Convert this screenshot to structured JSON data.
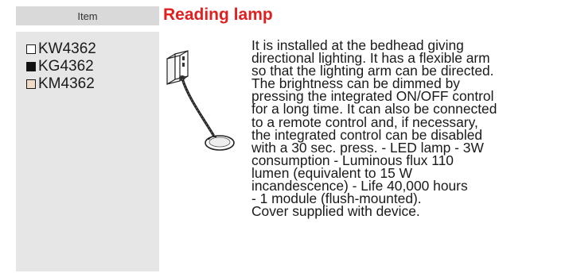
{
  "sidebar": {
    "header_label": "Item",
    "variants": [
      {
        "code": "KW4362",
        "swatch_color": "#ffffff"
      },
      {
        "code": "KG4362",
        "swatch_color": "#111111"
      },
      {
        "code": "KM4362",
        "swatch_color": "#f3dcc7"
      }
    ]
  },
  "product": {
    "title": "Reading lamp",
    "title_color": "#e02020",
    "description_lines": [
      "It is installed at the bedhead giving",
      "directional lighting. It has a flexible arm",
      "so that the lighting arm can be directed.",
      "The brightness can be dimmed by",
      "pressing the integrated ON/OFF control",
      "for a long time. It can also be connected",
      "to a remote control and, if  necessary,",
      "the integrated control can be disabled",
      "with a 30 sec. press. - LED lamp - 3W",
      "consumption - Luminous flux 110",
      "lumen (equivalent to 15 W",
      "incandescence) - Life 40,000 hours",
      "- 1 module (flush-mounted).",
      "Cover supplied with device."
    ]
  }
}
